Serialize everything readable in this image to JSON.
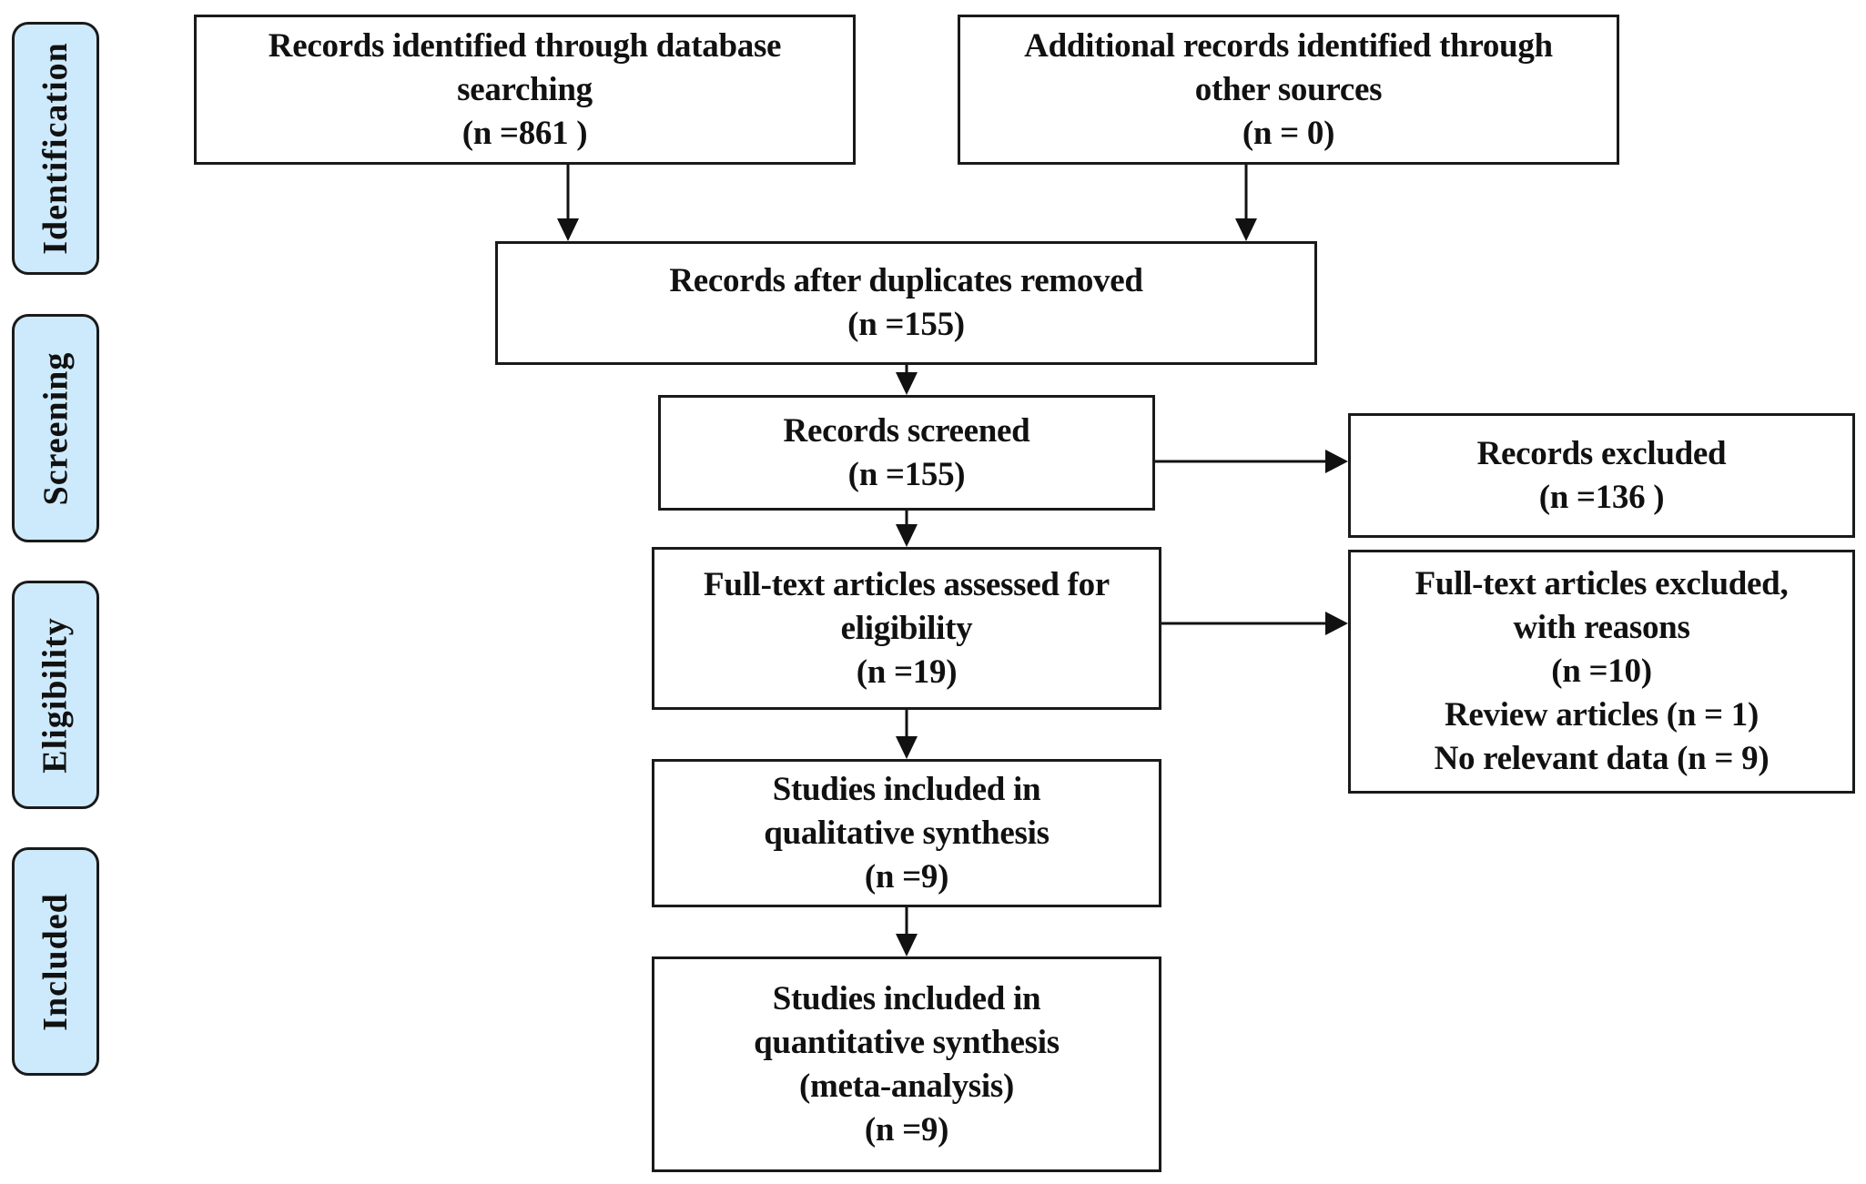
{
  "stages": [
    "Identification",
    "Screening",
    "Eligibility",
    "Included"
  ],
  "boxes": {
    "database_records": {
      "lines": [
        "Records identified through database",
        "searching",
        "(n =861 )"
      ]
    },
    "other_records": {
      "lines": [
        "Additional records identified through",
        "other sources",
        "(n = 0)"
      ]
    },
    "after_duplicates": {
      "lines": [
        "Records after duplicates removed",
        "(n =155)"
      ]
    },
    "screened": {
      "lines": [
        "Records screened",
        "(n =155)"
      ]
    },
    "excluded": {
      "lines": [
        "Records excluded",
        "(n =136 )"
      ]
    },
    "fulltext_assessed": {
      "lines": [
        "Full-text articles assessed for",
        "eligibility",
        "(n =19)"
      ]
    },
    "fulltext_excluded": {
      "lines": [
        "Full-text articles excluded,",
        "with reasons",
        "(n =10)",
        "Review articles (n = 1)",
        "No relevant data (n = 9)"
      ]
    },
    "qualitative": {
      "lines": [
        "Studies included in",
        "qualitative synthesis",
        "(n =9)"
      ]
    },
    "quantitative": {
      "lines": [
        "Studies included in",
        "quantitative synthesis",
        "(meta-analysis)",
        "(n =9)"
      ]
    }
  },
  "colors": {
    "stage_fill": "#cdeafc",
    "stroke": "#1a1a1a"
  }
}
